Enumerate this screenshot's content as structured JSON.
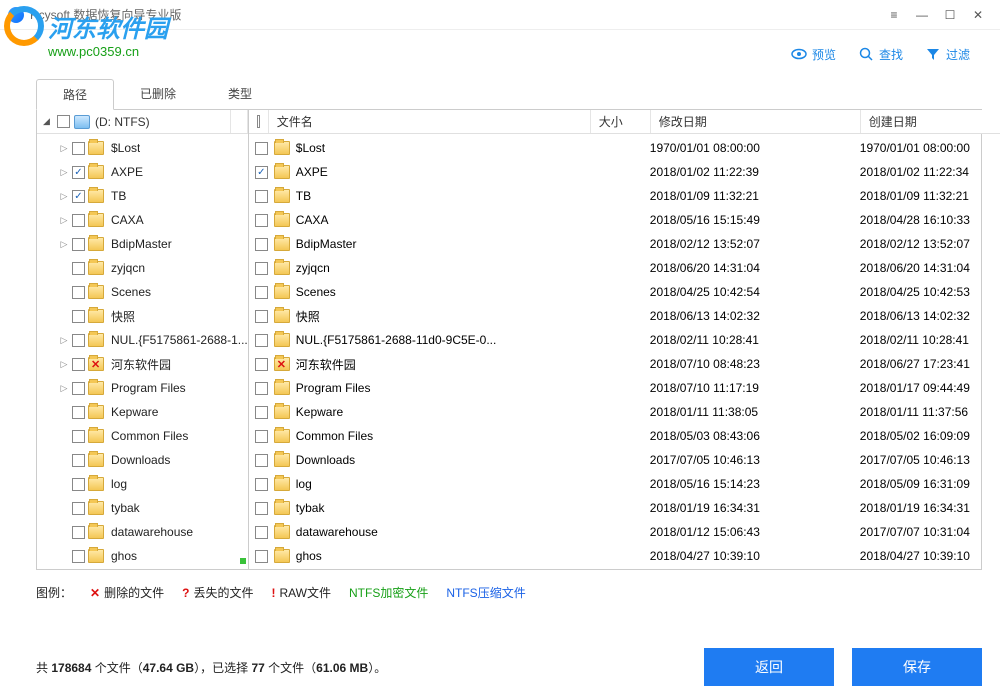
{
  "app": {
    "title": "Rcysoft 数据恢复向导专业版"
  },
  "watermark": {
    "brand": "河东软件园",
    "url": "www.pc0359.cn"
  },
  "toolbar": {
    "preview": "预览",
    "search": "查找",
    "filter": "过滤"
  },
  "tabs": {
    "path": "路径",
    "deleted": "已删除",
    "type": "类型"
  },
  "columns": {
    "filename": "文件名",
    "size": "大小",
    "modified": "修改日期",
    "created": "创建日期"
  },
  "tree": {
    "root": "(D: NTFS)",
    "items": [
      {
        "name": "$Lost",
        "checked": false,
        "expandable": true,
        "redx": false
      },
      {
        "name": "AXPE",
        "checked": true,
        "expandable": true,
        "redx": false
      },
      {
        "name": "TB",
        "checked": true,
        "expandable": true,
        "redx": false
      },
      {
        "name": "CAXA",
        "checked": false,
        "expandable": true,
        "redx": false
      },
      {
        "name": "BdipMaster",
        "checked": false,
        "expandable": true,
        "redx": false
      },
      {
        "name": "zyjqcn",
        "checked": false,
        "expandable": false,
        "redx": false
      },
      {
        "name": "Scenes",
        "checked": false,
        "expandable": false,
        "redx": false
      },
      {
        "name": "快照",
        "checked": false,
        "expandable": false,
        "redx": false
      },
      {
        "name": "NUL.{F5175861-2688-1...",
        "checked": false,
        "expandable": true,
        "redx": false
      },
      {
        "name": "河东软件园",
        "checked": false,
        "expandable": true,
        "redx": true
      },
      {
        "name": "Program Files",
        "checked": false,
        "expandable": true,
        "redx": false
      },
      {
        "name": "Kepware",
        "checked": false,
        "expandable": false,
        "redx": false
      },
      {
        "name": "Common Files",
        "checked": false,
        "expandable": false,
        "redx": false
      },
      {
        "name": "Downloads",
        "checked": false,
        "expandable": false,
        "redx": false
      },
      {
        "name": "log",
        "checked": false,
        "expandable": false,
        "redx": false
      },
      {
        "name": "tybak",
        "checked": false,
        "expandable": false,
        "redx": false
      },
      {
        "name": "datawarehouse",
        "checked": false,
        "expandable": false,
        "redx": false
      },
      {
        "name": "ghos",
        "checked": false,
        "expandable": false,
        "redx": false
      }
    ]
  },
  "files": [
    {
      "name": "$Lost",
      "checked": false,
      "redx": false,
      "size": "",
      "modified": "1970/01/01 08:00:00",
      "created": "1970/01/01 08:00:00"
    },
    {
      "name": "AXPE",
      "checked": true,
      "redx": false,
      "size": "",
      "modified": "2018/01/02 11:22:39",
      "created": "2018/01/02 11:22:34"
    },
    {
      "name": "TB",
      "checked": false,
      "redx": false,
      "size": "",
      "modified": "2018/01/09 11:32:21",
      "created": "2018/01/09 11:32:21"
    },
    {
      "name": "CAXA",
      "checked": false,
      "redx": false,
      "size": "",
      "modified": "2018/05/16 15:15:49",
      "created": "2018/04/28 16:10:33"
    },
    {
      "name": "BdipMaster",
      "checked": false,
      "redx": false,
      "size": "",
      "modified": "2018/02/12 13:52:07",
      "created": "2018/02/12 13:52:07"
    },
    {
      "name": "zyjqcn",
      "checked": false,
      "redx": false,
      "size": "",
      "modified": "2018/06/20 14:31:04",
      "created": "2018/06/20 14:31:04"
    },
    {
      "name": "Scenes",
      "checked": false,
      "redx": false,
      "size": "",
      "modified": "2018/04/25 10:42:54",
      "created": "2018/04/25 10:42:53"
    },
    {
      "name": "快照",
      "checked": false,
      "redx": false,
      "size": "",
      "modified": "2018/06/13 14:02:32",
      "created": "2018/06/13 14:02:32"
    },
    {
      "name": "NUL.{F5175861-2688-11d0-9C5E-0...",
      "checked": false,
      "redx": false,
      "size": "",
      "modified": "2018/02/11 10:28:41",
      "created": "2018/02/11 10:28:41"
    },
    {
      "name": "河东软件园",
      "checked": false,
      "redx": true,
      "size": "",
      "modified": "2018/07/10 08:48:23",
      "created": "2018/06/27 17:23:41"
    },
    {
      "name": "Program Files",
      "checked": false,
      "redx": false,
      "size": "",
      "modified": "2018/07/10 11:17:19",
      "created": "2018/01/17 09:44:49"
    },
    {
      "name": "Kepware",
      "checked": false,
      "redx": false,
      "size": "",
      "modified": "2018/01/11 11:38:05",
      "created": "2018/01/11 11:37:56"
    },
    {
      "name": "Common Files",
      "checked": false,
      "redx": false,
      "size": "",
      "modified": "2018/05/03 08:43:06",
      "created": "2018/05/02 16:09:09"
    },
    {
      "name": "Downloads",
      "checked": false,
      "redx": false,
      "size": "",
      "modified": "2017/07/05 10:46:13",
      "created": "2017/07/05 10:46:13"
    },
    {
      "name": "log",
      "checked": false,
      "redx": false,
      "size": "",
      "modified": "2018/05/16 15:14:23",
      "created": "2018/05/09 16:31:09"
    },
    {
      "name": "tybak",
      "checked": false,
      "redx": false,
      "size": "",
      "modified": "2018/01/19 16:34:31",
      "created": "2018/01/19 16:34:31"
    },
    {
      "name": "datawarehouse",
      "checked": false,
      "redx": false,
      "size": "",
      "modified": "2018/01/12 15:06:43",
      "created": "2017/07/07 10:31:04"
    },
    {
      "name": "ghos",
      "checked": false,
      "redx": false,
      "size": "",
      "modified": "2018/04/27 10:39:10",
      "created": "2018/04/27 10:39:10"
    }
  ],
  "legend": {
    "label": "图例：",
    "deleted": "删除的文件",
    "lost": "丢失的文件",
    "raw": "RAW文件",
    "encrypted": "NTFS加密文件",
    "compressed": "NTFS压缩文件"
  },
  "stats": {
    "prefix": "共 ",
    "total_files": "178684",
    "mid1": " 个文件（",
    "total_size": "47.64 GB",
    "mid2": "），已选择 ",
    "sel_files": "77",
    "mid3": " 个文件（",
    "sel_size": "61.06 MB",
    "suffix": "）。"
  },
  "buttons": {
    "back": "返回",
    "save": "保存"
  }
}
